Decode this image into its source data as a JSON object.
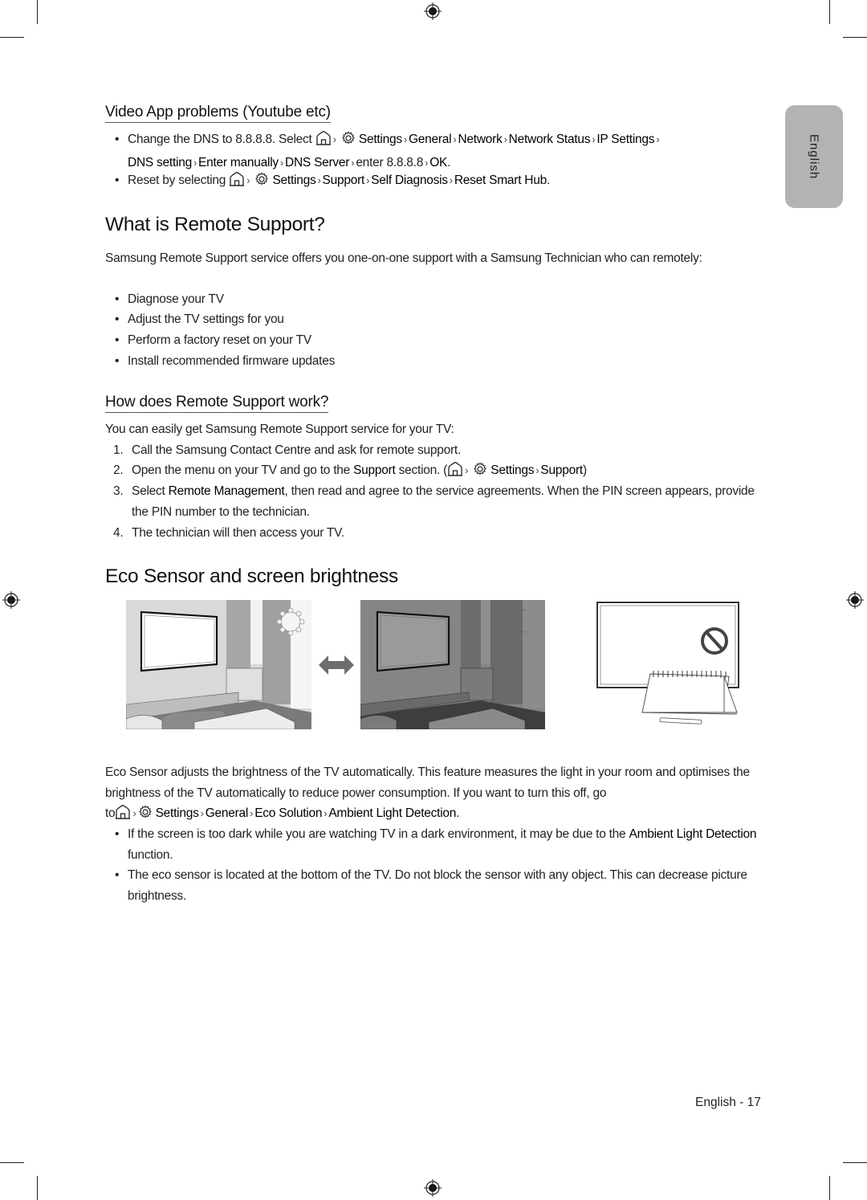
{
  "side_tab": {
    "label": "English"
  },
  "section_video": {
    "heading": "Video App problems (Youtube etc)",
    "bullets": [
      {
        "prefix": "Change the DNS to 8.8.8.8. Select",
        "path": [
          "Settings",
          "General",
          "Network",
          "Network Status",
          "IP Settings",
          "DNS setting",
          "Enter manually",
          "DNS Server"
        ],
        "tail_plain": "enter 8.8.8.8",
        "tail_end": "OK",
        "suffix": "."
      },
      {
        "prefix": "Reset by selecting",
        "path": [
          "Settings",
          "Support",
          "Self Diagnosis",
          "Reset Smart Hub"
        ],
        "suffix": "."
      }
    ]
  },
  "section_remote": {
    "heading": "What is Remote Support?",
    "intro": "Samsung Remote Support service offers you one-on-one support with a Samsung Technician who can remotely:",
    "bullets": [
      "Diagnose your TV",
      "Adjust the TV settings for you",
      "Perform a factory reset on your TV",
      "Install recommended firmware updates"
    ],
    "how": {
      "heading": "How does Remote Support work?",
      "intro": "You can easily get Samsung Remote Support service for your TV:",
      "steps": [
        {
          "num": "1.",
          "text": "Call the Samsung Contact Centre and ask for remote support."
        },
        {
          "num": "2.",
          "pre": "Open the menu on your TV and go to the",
          "em": "Support",
          "post": "section. (",
          "path": [
            "Settings",
            "Support"
          ],
          "close": ")"
        },
        {
          "num": "3.",
          "pre": "Select",
          "em": "Remote Management",
          "post": ", then read and agree to the service agreements. When the PIN screen appears, provide the PIN number to the technician."
        },
        {
          "num": "4.",
          "text": "The technician will then access your TV."
        }
      ]
    }
  },
  "section_eco": {
    "heading": "Eco Sensor and screen brightness",
    "figures": [
      "bright-room-illustration",
      "double-arrow",
      "dark-room-illustration",
      "blocked-sensor-illustration"
    ],
    "body_1": "Eco Sensor adjusts the brightness of the TV automatically. This feature measures the light in your room and optimises the brightness of the TV automatically to reduce power consumption. If you want to turn this off, go",
    "body_to": "to",
    "path": [
      "Settings",
      "General",
      "Eco Solution",
      "Ambient Light Detection"
    ],
    "suffix": ".",
    "bullets": [
      {
        "pre": "If the screen is too dark while you are watching TV in a dark environment, it may be due to the",
        "em": "Ambient Light Detection",
        "post": "function."
      },
      {
        "text": "The eco sensor is located at the bottom of the TV. Do not block the sensor with any object. This can decrease picture brightness."
      }
    ]
  },
  "footer": {
    "page_label": "English - 17"
  },
  "icons": {
    "home": "home-icon",
    "settings": "gear-icon",
    "separator": "›"
  }
}
